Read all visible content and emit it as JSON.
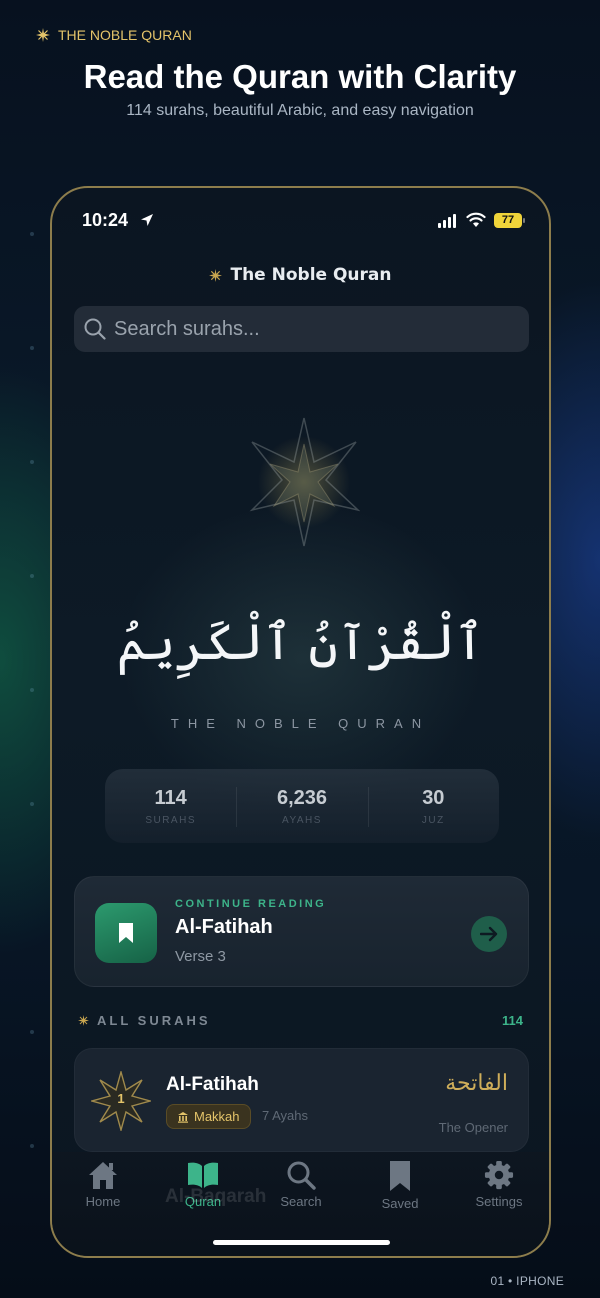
{
  "promo": {
    "brand": "THE NOBLE QURAN",
    "headline": "Read the Quran with Clarity",
    "subheadline": "114 surahs, beautiful Arabic, and easy navigation",
    "footer": "01 • IPHONE"
  },
  "status_bar": {
    "time": "10:24",
    "battery": "77"
  },
  "app": {
    "title": "The Noble Quran"
  },
  "search": {
    "placeholder": "Search surahs..."
  },
  "hero": {
    "arabic": "ٱلْقُرْآنُ ٱلْكَرِيمُ",
    "latin": "THE NOBLE QURAN"
  },
  "stats": [
    {
      "value": "114",
      "label": "SURAHS"
    },
    {
      "value": "6,236",
      "label": "AYAHS"
    },
    {
      "value": "30",
      "label": "JUZ"
    }
  ],
  "continue_reading": {
    "label": "CONTINUE READING",
    "surah": "Al-Fatihah",
    "verse": "Verse 3"
  },
  "all_surahs": {
    "label": "ALL SURAHS",
    "count": "114",
    "items": [
      {
        "number": "1",
        "name": "Al-Fatihah",
        "revelation": "Makkah",
        "ayahs": "7 Ayahs",
        "arabic": "الفاتحة",
        "meaning": "The Opener"
      }
    ],
    "partial_next": "Al-Baqarah"
  },
  "tabs": [
    {
      "label": "Home",
      "icon": "home-icon",
      "active": false
    },
    {
      "label": "Quran",
      "icon": "book-icon",
      "active": true
    },
    {
      "label": "Search",
      "icon": "search-icon",
      "active": false
    },
    {
      "label": "Saved",
      "icon": "bookmark-icon",
      "active": false
    },
    {
      "label": "Settings",
      "icon": "gear-icon",
      "active": false
    }
  ],
  "colors": {
    "accent_green": "#3db48a",
    "accent_gold": "#e4c46a",
    "frame_gold": "#8d7d4c"
  }
}
